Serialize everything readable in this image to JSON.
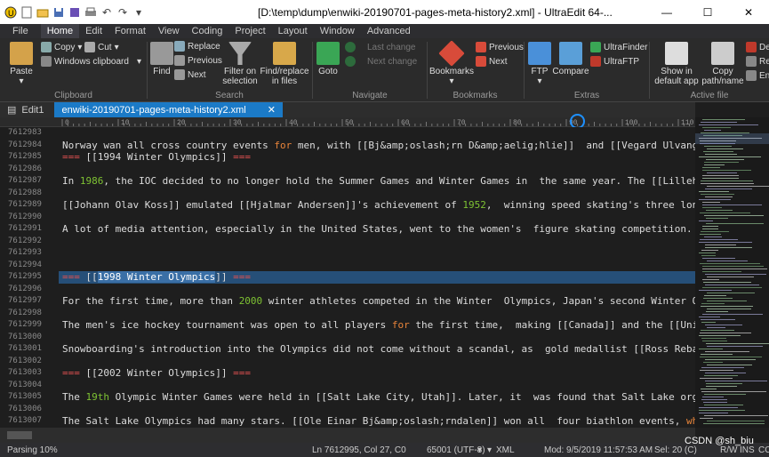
{
  "title": "[D:\\temp\\dump\\enwiki-20190701-pages-meta-history2.xml] - UltraEdit 64-...",
  "menu": [
    "File",
    "Home",
    "Edit",
    "Format",
    "View",
    "Coding",
    "Project",
    "Layout",
    "Window",
    "Advanced"
  ],
  "ribbon": {
    "clipboard": {
      "paste": "Paste",
      "copy": "Copy",
      "cut": "Cut",
      "windows_clipboard": "Windows clipboard",
      "label": "Clipboard"
    },
    "search": {
      "find": "Find",
      "replace": "Replace",
      "previous": "Previous",
      "next": "Next",
      "filter": "Filter on selection",
      "findreplace": "Find/replace in files",
      "label": "Search"
    },
    "navigate": {
      "goto": "Goto",
      "last_change": "Last change",
      "next_change": "Next change",
      "label": "Navigate"
    },
    "bookmarks": {
      "bookmarks": "Bookmarks",
      "previous": "Previous",
      "next": "Next",
      "label": "Bookmarks"
    },
    "extras": {
      "ftp": "FTP",
      "compare": "Compare",
      "ultrafinder": "UltraFinder",
      "ultraftp": "UltraFTP",
      "label": "Extras"
    },
    "active_file": {
      "show_in_default": "Show in default app",
      "copy_path": "Copy path/name",
      "label": "Active file",
      "de": "De",
      "re": "Re",
      "en": "En"
    }
  },
  "tabs": [
    {
      "label": "Edit1",
      "active": false
    },
    {
      "label": "enwiki-20190701-pages-meta-history2.xml",
      "active": true
    }
  ],
  "ruler": "0,,,,,,,,,10,,,,,,,,,20,,,,,,,,,30,,,,,,,,,40,,,,,,,,,50,,,,,,,,,60,,,,,,,,,70,,,,,,,,,80,,,,,,,,,90,,,,,,,,,100,,,,,,,,,110",
  "line_numbers": [
    "7612983",
    "7612984",
    "7612985",
    "7612986",
    "7612987",
    "7612988",
    "7612989",
    "7612990",
    "7612991",
    "7612992",
    "7612993",
    "7612994",
    "7612995",
    "7612996",
    "7612997",
    "7612998",
    "7612999",
    "7613000",
    "7613001",
    "7613002",
    "7613003",
    "7613004",
    "7613005",
    "7613006",
    "7613007"
  ],
  "code_lines": [
    [],
    [
      {
        "t": "Norway wan all cross country events "
      },
      {
        "t": "for",
        "c": "kw"
      },
      {
        "t": " men, with [[Bj&amp;oslash;rn D&amp;aelig;hlie]]  and [[Vegard Ulvang]] ea"
      }
    ],
    [
      {
        "t": "=== ",
        "c": "hdr"
      },
      {
        "t": "[[1994 Winter Olympics]]"
      },
      {
        "t": " ===",
        "c": "hdr"
      }
    ],
    [],
    [
      {
        "t": "In "
      },
      {
        "t": "1986",
        "c": "num"
      },
      {
        "t": ", the IOC decided to no longer hold the Summer Games and Winter Games in  the same year. The [[Lillehammer"
      }
    ],
    [],
    [
      {
        "t": "[[Johann Olav Koss]] emulated [[Hjalmar Andersen]]'s achievement of "
      },
      {
        "t": "1952",
        "c": "num"
      },
      {
        "t": ",  winning speed skating's three longest"
      }
    ],
    [],
    [
      {
        "t": "A lot of media attention, especially in the United States, went to the women's  figure skating competition. Ameri"
      }
    ],
    [],
    [],
    [],
    [
      {
        "t": "=== ",
        "c": "hdr"
      },
      {
        "t": "[["
      },
      {
        "t": "1998 Winter Olympics",
        "c": "sel"
      },
      {
        "t": "]]"
      },
      {
        "t": " ===",
        "c": "hdr"
      }
    ],
    [],
    [
      {
        "t": "For the first time, more than "
      },
      {
        "t": "2000",
        "c": "num"
      },
      {
        "t": " winter athletes competed in the Winter  Olympics, Japan's second Winter Olympi"
      }
    ],
    [],
    [
      {
        "t": "The men's ice hockey tournament was open to all players "
      },
      {
        "t": "for",
        "c": "kw"
      },
      {
        "t": " the first time,  making [[Canada]] and the [[United S"
      }
    ],
    [],
    [
      {
        "t": "Snowboarding's introduction into the Olympics did not come without a scandal, as  gold medallist [[Ross Rebagliat"
      }
    ],
    [],
    [
      {
        "t": "=== ",
        "c": "hdr"
      },
      {
        "t": "[[2002 Winter Olympics]]"
      },
      {
        "t": " ===",
        "c": "hdr"
      }
    ],
    [],
    [
      {
        "t": "The "
      },
      {
        "t": "19th",
        "c": "num"
      },
      {
        "t": " Olympic Winter Games were held in [[Salt Lake City, Utah]]. Later, it  was found that Salt Lake organize"
      }
    ],
    [],
    [
      {
        "t": "The Salt Lake Olympics had many stars. [[Ole Einar Bj&amp;oslash;rndalen]] won all  four biathlon events, "
      },
      {
        "t": "while",
        "c": "kw"
      },
      {
        "t": " ["
      }
    ]
  ],
  "status": {
    "parsing": "Parsing 10%",
    "position": "Ln 7612995, Col 27, C0",
    "encoding": "65001 (UTF-8)",
    "filetype": "XML",
    "modified": "Mod: 9/5/2019 11:57:53 AM",
    "selection": "Sel: 20 (C)",
    "rw": "R/W",
    "ins": "INS",
    "col": "CC"
  },
  "watermark": "CSDN @sh_biu",
  "colors": {
    "accent": "#1b7ac7",
    "keyword": "#e8843a",
    "number": "#7ec233",
    "header": "#e05050"
  }
}
